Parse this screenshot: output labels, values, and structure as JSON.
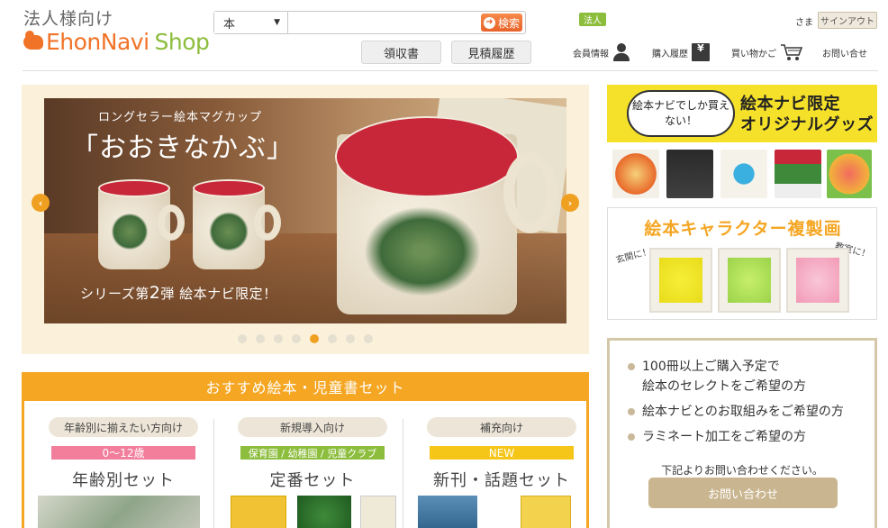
{
  "header": {
    "logo_top": "法人様向け",
    "logo_brand_1": "EhonNavi",
    "logo_brand_2": "Shop",
    "search_category": "本",
    "search_placeholder": "",
    "search_button": "検索",
    "receipt_button": "領収書",
    "quote_history_button": "見積履歴",
    "corporate_badge": "法人",
    "honorific": "さま",
    "signout_button": "サインアウト",
    "nav": {
      "member": "会員情報",
      "purchase_history": "購入履歴",
      "cart": "買い物かご",
      "contact": "お問い合せ"
    }
  },
  "hero": {
    "kicker": "ロングセラー絵本マグカップ",
    "title": "「おおきなかぶ」",
    "subtitle_prefix": "シリーズ第",
    "subtitle_number": "2",
    "subtitle_suffix": "弾 絵本ナビ限定！",
    "prev_arrow": "‹",
    "next_arrow": "›",
    "slide_count": 8,
    "active_slide": 5
  },
  "sets": {
    "heading": "おすすめ絵本・児童書セット",
    "columns": [
      {
        "pill": "年齢別に揃えたい方向け",
        "tag": "0～12歳",
        "name": "年齢別セット"
      },
      {
        "pill": "新規導入向け",
        "tag": "保育園 / 幼稚園 / 児童クラブ",
        "name": "定番セット"
      },
      {
        "pill": "補充向け",
        "tag": "NEW",
        "name": "新刊・話題セット"
      }
    ]
  },
  "banner_goods": {
    "cloud_text": "絵本ナビでしか買えない！",
    "title_line1": "絵本ナビ限定",
    "title_line2": "オリジナルグッズ"
  },
  "banner_art": {
    "title": "絵本キャラクター複製画",
    "left_note": "玄関に！",
    "right_note": "教室に！"
  },
  "contact_box": {
    "bullets": [
      "100冊以上ご購入予定で",
      "絵本のセレクトをご希望の方",
      "絵本ナビとのお取組みをご希望の方",
      "ラミネート加工をご希望の方"
    ],
    "note": "下記よりお問い合わせください。",
    "button": "お問い合わせ"
  },
  "colors": {
    "brand_orange": "#f07328",
    "brand_green": "#8cbd3c",
    "accent_amber": "#f5a623",
    "beige": "#c9b58f"
  }
}
